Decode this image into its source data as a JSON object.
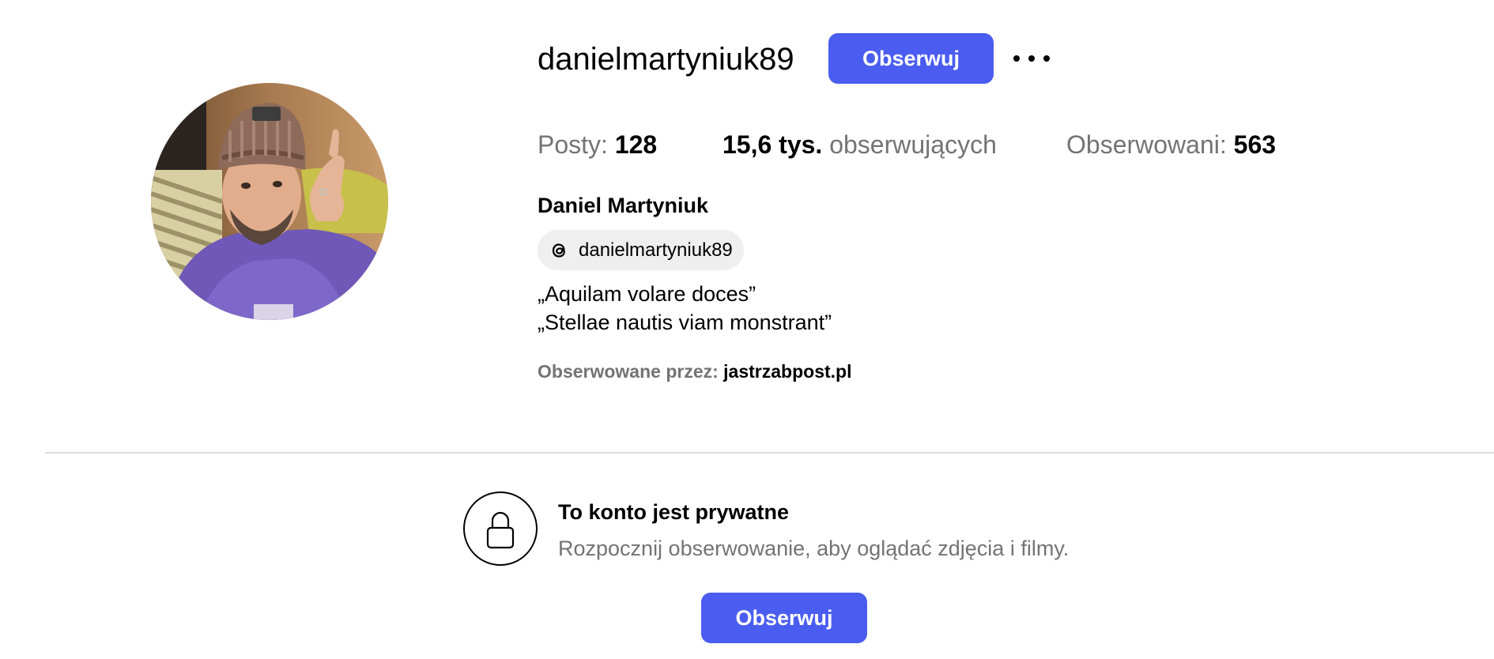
{
  "profile": {
    "username": "danielmartyniuk89",
    "follow_label": "Obserwuj",
    "more_icon": "more-horizontal-icon",
    "full_name": "Daniel Martyniuk",
    "threads_handle": "danielmartyniuk89",
    "threads_icon": "threads-icon",
    "bio_lines": [
      "„Aquilam volare doces”",
      "„Stellae nautis viam monstrant”"
    ]
  },
  "stats": {
    "posts_label": "Posty:",
    "posts_value": "128",
    "followers_value": "15,6 tys.",
    "followers_label": "obserwujących",
    "following_label": "Obserwowani:",
    "following_value": "563"
  },
  "followed_by": {
    "label": "Obserwowane przez:",
    "account": "jastrzabpost.pl"
  },
  "private": {
    "lock_icon": "lock-icon",
    "title": "To konto jest prywatne",
    "subtitle": "Rozpocznij obserwowanie, aby oglądać zdjęcia i filmy.",
    "follow_label": "Obserwuj"
  },
  "colors": {
    "accent": "#4a5df0",
    "secondary_text": "#737373",
    "pill_bg": "#efefef",
    "divider": "#dbdbdb"
  }
}
